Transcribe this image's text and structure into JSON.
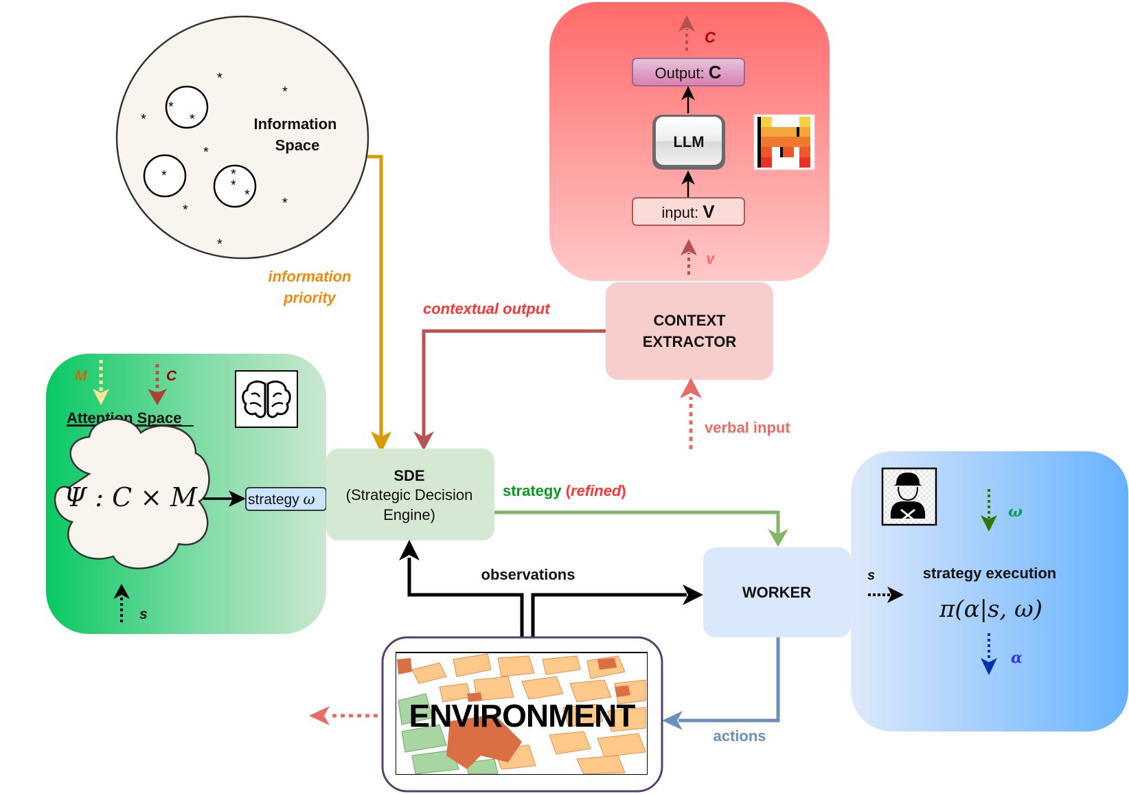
{
  "colors": {
    "llm_panel_top": "#ff6b6b",
    "llm_panel_bottom": "#ffc9c9",
    "attention_panel_left": "#0bc864",
    "attention_panel_right": "#c8e6cc",
    "worker_panel_left": "#dbe9fb",
    "worker_panel_right": "#64b0ff",
    "info_priority": "#f08a0c",
    "contextual_output_arrow": "#b85450",
    "contextual_output_text": "#ff3333",
    "strategy_arrow": "#82b366",
    "strategy_text": "#0a9b1e",
    "refined_text": "#ff3333",
    "actions_arrow": "#6c8ebf",
    "verbal_input": "#ea6b66",
    "info_arrow": "#d79b00",
    "omega_color": "#0a9b5a",
    "alpha_color": "#3333ff"
  },
  "information_space": {
    "title_line1": "Information",
    "title_line2": "Space",
    "star_glyph": "*"
  },
  "information_priority": {
    "line1": "information",
    "line2": "priority"
  },
  "llm_panel": {
    "output_prefix": "Output: ",
    "output_var": "C",
    "llm_label": "LLM",
    "input_prefix": "input: ",
    "input_var": "V",
    "out_arrow_label": "C",
    "in_arrow_label": "v"
  },
  "context_extractor": {
    "line1": "CONTEXT",
    "line2": "EXTRACTOR"
  },
  "contextual_output_label": "contextual output",
  "verbal_input_label": "verbal input",
  "attention_space": {
    "title": "Attention Space",
    "m_label": "M",
    "c_label": "C",
    "s_label": "s",
    "formula": "Ψ : C × M",
    "strategy_box_prefix": "strategy ",
    "strategy_box_var": "ω"
  },
  "sde": {
    "title": "SDE",
    "line2": "(Strategic Decision",
    "line3": "Engine)"
  },
  "strategy_label": {
    "word": "strategy ",
    "open": "(",
    "refined": "refined",
    "close": ")"
  },
  "observations_label": "observations",
  "worker": {
    "label": "WORKER"
  },
  "worker_panel": {
    "s_label": "s",
    "title": "strategy execution",
    "formula": "π(α|s, ω)",
    "omega_label": "ω",
    "alpha_label": "α"
  },
  "environment": {
    "label": "ENVIRONMENT"
  },
  "actions_label": "actions",
  "icons": {
    "brain": "brain-icon",
    "worker": "construction-worker-icon",
    "mistral": "mistral-logo-icon"
  }
}
